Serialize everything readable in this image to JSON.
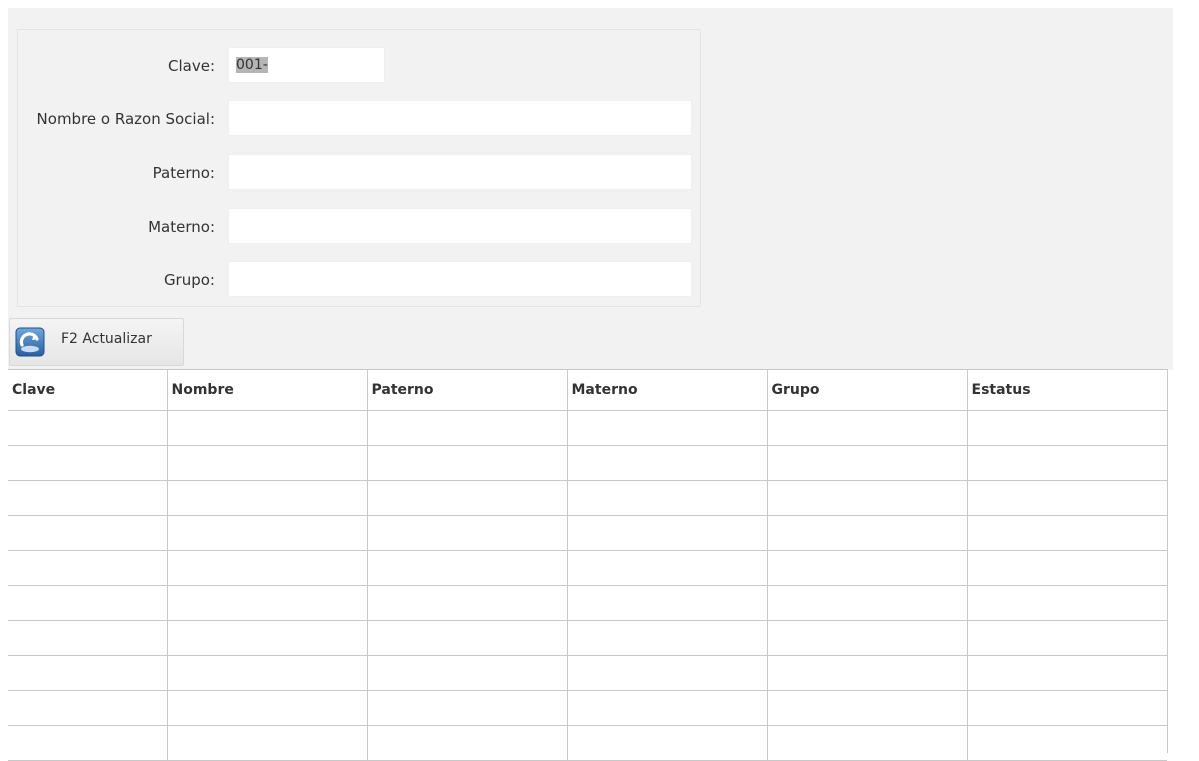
{
  "form": {
    "clave_label": "Clave:",
    "clave_value": "001-",
    "nombre_label": "Nombre o Razon Social:",
    "nombre_value": "",
    "paterno_label": "Paterno:",
    "paterno_value": "",
    "materno_label": "Materno:",
    "materno_value": "",
    "grupo_label": "Grupo:",
    "grupo_value": ""
  },
  "toolbar": {
    "refresh_label": "F2 Actualizar",
    "refresh_icon": "refresh-icon"
  },
  "table": {
    "columns": [
      "Clave",
      "Nombre",
      "Paterno",
      "Materno",
      "Grupo",
      "Estatus"
    ],
    "rows": [
      [
        "",
        "",
        "",
        "",
        "",
        ""
      ],
      [
        "",
        "",
        "",
        "",
        "",
        ""
      ],
      [
        "",
        "",
        "",
        "",
        "",
        ""
      ],
      [
        "",
        "",
        "",
        "",
        "",
        ""
      ],
      [
        "",
        "",
        "",
        "",
        "",
        ""
      ],
      [
        "",
        "",
        "",
        "",
        "",
        ""
      ],
      [
        "",
        "",
        "",
        "",
        "",
        ""
      ],
      [
        "",
        "",
        "",
        "",
        "",
        ""
      ],
      [
        "",
        "",
        "",
        "",
        "",
        ""
      ],
      [
        "",
        "",
        "",
        "",
        "",
        ""
      ]
    ]
  },
  "colors": {
    "panel_background": "#f2f2f2",
    "grid_line": "#c8c8c8",
    "selection": "#b5b5b5"
  }
}
